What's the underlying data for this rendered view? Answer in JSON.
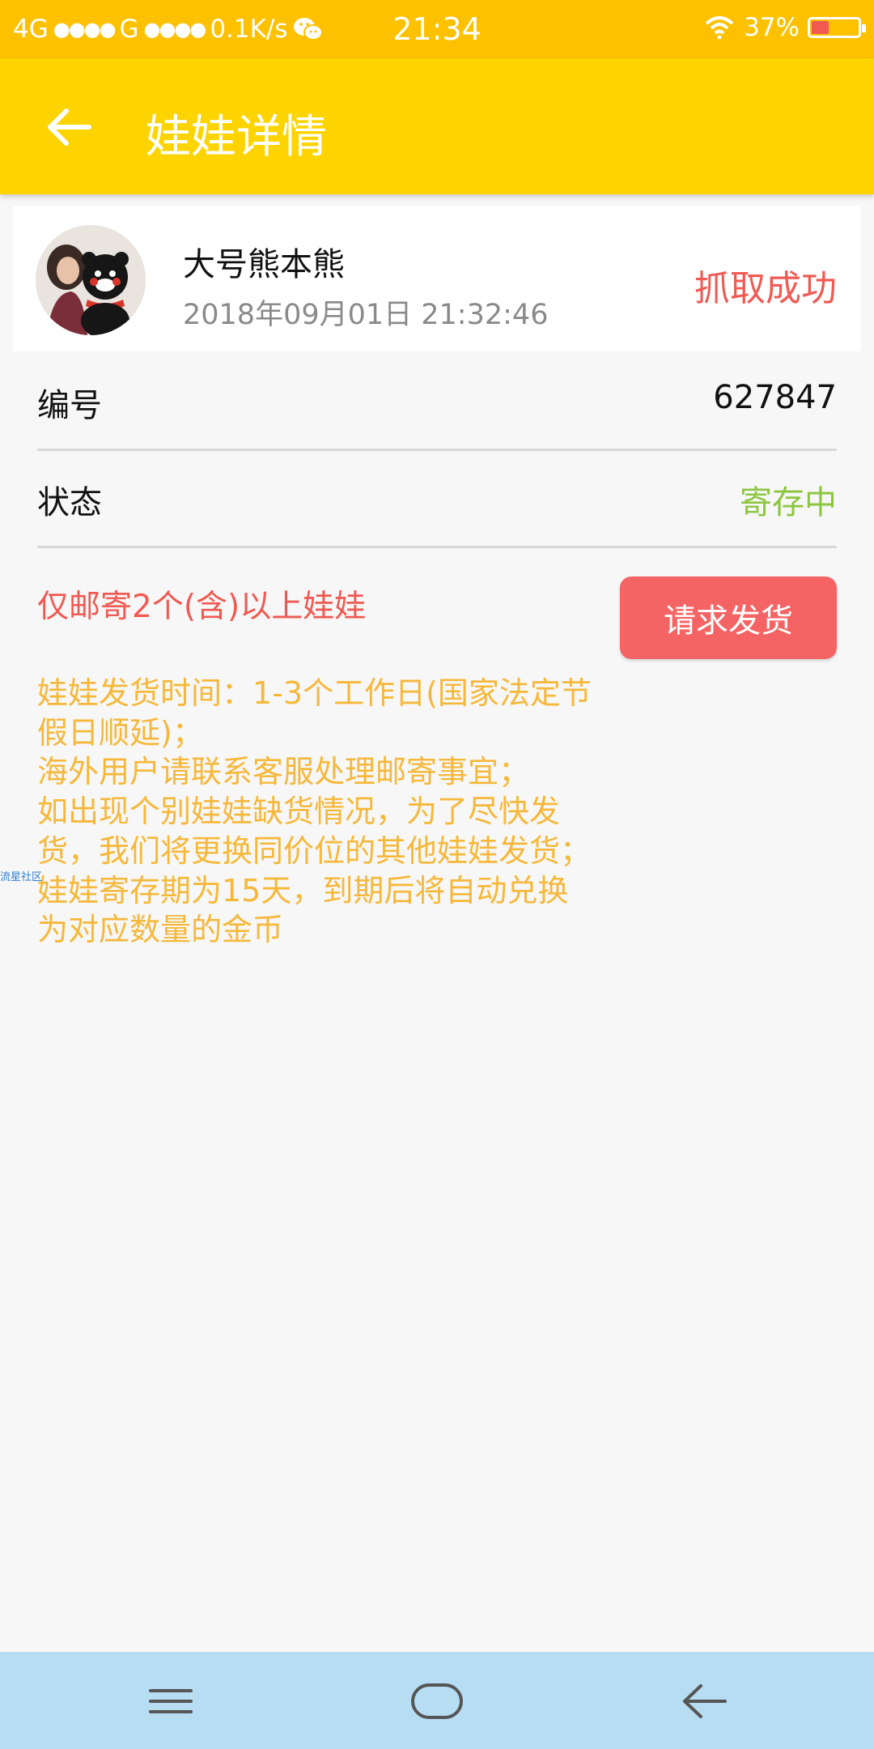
{
  "status_bar": {
    "network_1": "4G",
    "network_2": "G",
    "speed": "0.1K/s",
    "time": "21:34",
    "battery": "37%",
    "battery_level": 0.37,
    "icons": [
      "signal-dots",
      "wechat-icon",
      "wifi-icon",
      "battery-icon"
    ]
  },
  "header": {
    "title": "娃娃详情",
    "back_icon": "back-arrow-icon"
  },
  "doll_card": {
    "name": "大号熊本熊",
    "time": "2018年09月01日 21:32:46",
    "result": "抓取成功",
    "avatar": "user-avatar-with-bear"
  },
  "details": {
    "number_label": "编号",
    "number_value": "627847",
    "status_label": "状态",
    "status_value": "寄存中"
  },
  "shipping": {
    "min_notice": "仅邮寄2个(含)以上娃娃",
    "button_label": "请求发货",
    "notes": [
      "娃娃发货时间：1-3个工作日(国家法定节假日顺延)；",
      "海外用户请联系客服处理邮寄事宜；",
      "如出现个别娃娃缺货情况，为了尽快发货，我们将更换同价位的其他娃娃发货；",
      "娃娃寄存期为15天，到期后将自动兑换为对应数量的金币"
    ]
  },
  "watermark": "流星社区",
  "colors": {
    "status_bar": "#fdc100",
    "app_bar": "#fdd300",
    "accent_red": "#ef5a53",
    "button_red": "#f56464",
    "status_green": "#8cc63f",
    "notes_orange": "#f6b83a",
    "nav_bar": "#b7ddf3"
  },
  "nav_bar": {
    "icons": [
      "menu-icon",
      "home-icon",
      "back-icon"
    ]
  }
}
